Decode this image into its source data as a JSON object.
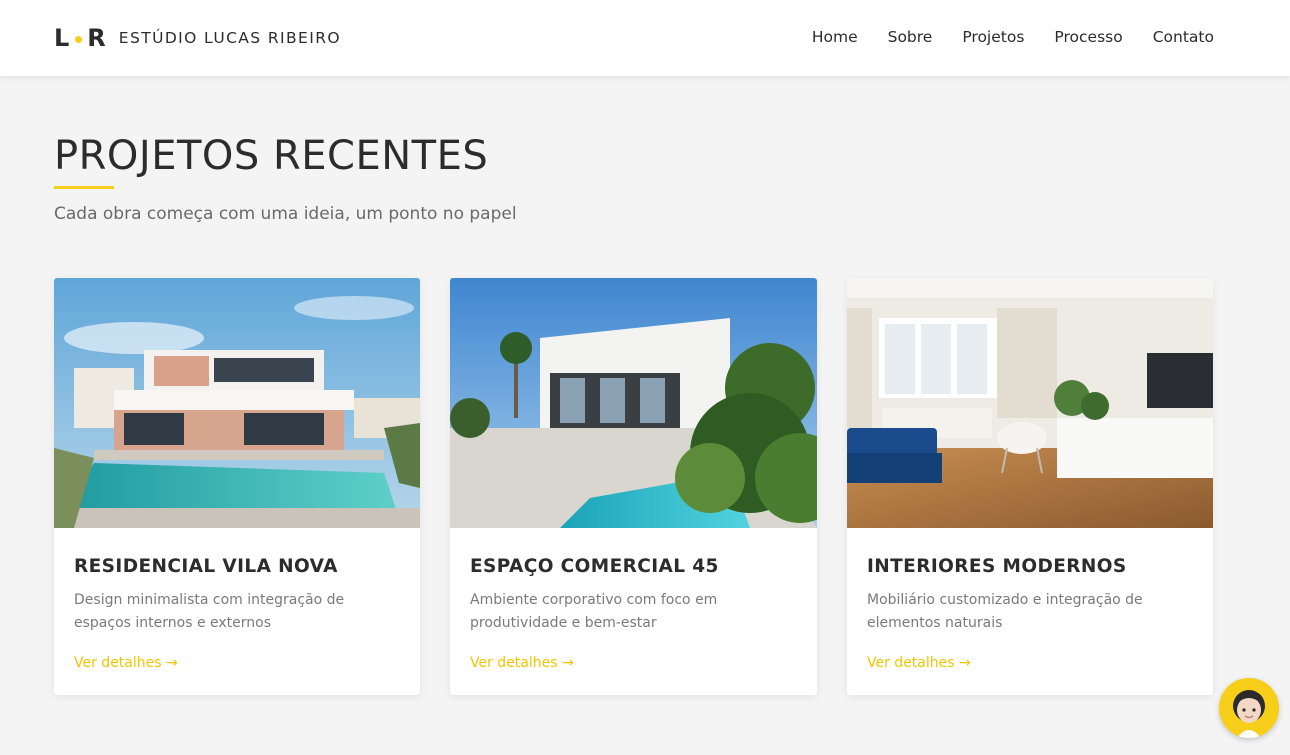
{
  "header": {
    "logo_left": "L",
    "logo_right": "R",
    "brand": "ESTÚDIO LUCAS RIBEIRO",
    "nav": [
      "Home",
      "Sobre",
      "Projetos",
      "Processo",
      "Contato"
    ]
  },
  "colors": {
    "accent": "#f7cf1b",
    "link": "#f2c500",
    "background": "#f4f4f4"
  },
  "section": {
    "title": "PROJETOS RECENTES",
    "subtitle": "Cada obra começa com uma ideia, um ponto no papel"
  },
  "cards": [
    {
      "image": "modern-house-with-pool-photo",
      "title": "RESIDENCIAL VILA NOVA",
      "description": "Design minimalista com integração de espaços internos e externos",
      "link": "Ver detalhes →"
    },
    {
      "image": "white-building-with-pool-and-plants-photo",
      "title": "ESPAÇO COMERCIAL 45",
      "description": "Ambiente corporativo com foco em produtividade e bem-estar",
      "link": "Ver detalhes →"
    },
    {
      "image": "living-room-interior-photo",
      "title": "INTERIORES MODERNOS",
      "description": "Mobiliário customizado e integração de elementos naturais",
      "link": "Ver detalhes →"
    }
  ],
  "chat": {
    "icon": "avatar-icon"
  }
}
